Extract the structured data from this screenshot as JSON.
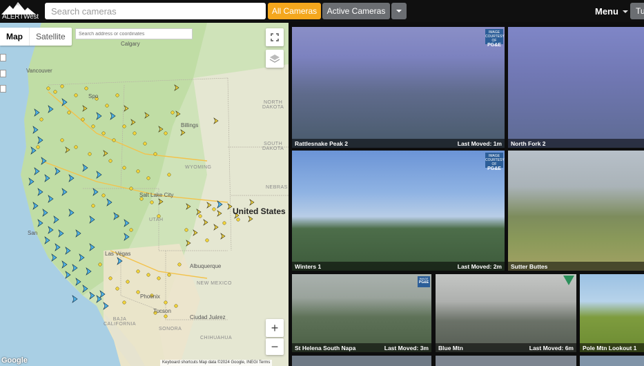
{
  "header": {
    "logo_text": "ALERTWest",
    "search_placeholder": "Search cameras",
    "all_cameras_label": "All Cameras",
    "active_cameras_label": "Active Cameras",
    "menu_label": "Menu",
    "truncated_label": "Tu"
  },
  "map": {
    "type_map": "Map",
    "type_satellite": "Satellite",
    "address_placeholder": "Search address or coordinates",
    "zoom_in": "+",
    "zoom_out": "−",
    "google_logo": "Google",
    "attribution": "Keyboard shortcuts   Map data ©2024 Google, INEGI   Terms",
    "labels": {
      "calgary": "Calgary",
      "vancouver": "Vancouver",
      "north_dakota": "NORTH\nDAKOTA",
      "south_dakota": "SOUTH\nDAKOTA",
      "billings": "Billings",
      "wyoming": "WYOMING",
      "nebraska": "NEBRAS",
      "salt_lake": "Salt Lake City",
      "utah": "UTAH",
      "united_states": "United States",
      "las_vegas": "Las Vegas",
      "albuquerque": "Albuquerque",
      "new_mexico": "NEW MEXICO",
      "phoenix": "Phoenix",
      "tucson": "Tucson",
      "ciudad_juarez": "Ciudad Juárez",
      "baja": "BAJA\nCALIFORNIA",
      "sonora": "SONORA",
      "chihuahua": "CHIHUAHUA",
      "san": "San",
      "spo": "Spo"
    }
  },
  "cameras": [
    {
      "name": "Rattlesnake Peak 2",
      "moved": "Last Moved: 1m",
      "badge": "PG&E"
    },
    {
      "name": "North Fork 2",
      "moved": "",
      "badge": ""
    },
    {
      "name": "Winters 1",
      "moved": "Last Moved: 2m",
      "badge": "PG&E"
    },
    {
      "name": "Sutter Buttes",
      "moved": "",
      "badge": ""
    },
    {
      "name": "St Helena South Napa",
      "moved": "Last Moved: 3m",
      "badge": "PG&E"
    },
    {
      "name": "Blue Mtn",
      "moved": "Last Moved: 6m",
      "badge": ""
    },
    {
      "name": "Pole Mtn Lookout 1",
      "moved": "",
      "badge": ""
    }
  ],
  "badge_text": {
    "top": "IMAGE",
    "sub": "COURTESY OF",
    "org": "PG&E"
  },
  "colors": {
    "all_cameras_btn": "#f4a71d",
    "active_cameras_btn": "#6b6e72",
    "pge_badge": "#2c5e98",
    "camera_marker_blue": "#4fb3e8",
    "camera_marker_yellow": "#f2d43b"
  },
  "icons": [
    "fullscreen-icon",
    "layers-icon",
    "mountain-logo-icon",
    "chevron-down-icon",
    "camera-marker-icon",
    "forest-service-icon"
  ]
}
